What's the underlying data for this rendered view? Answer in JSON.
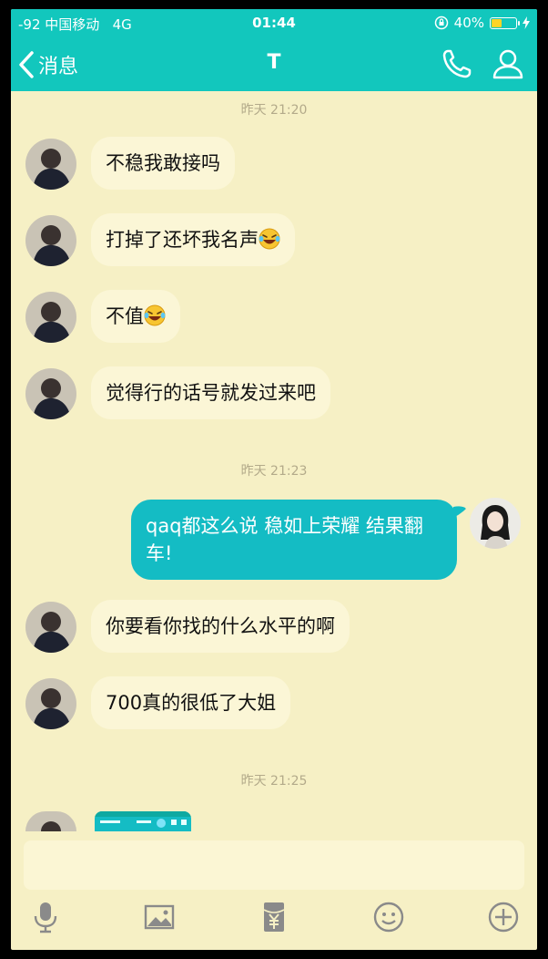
{
  "status_bar": {
    "carrier": "-92 中国移动",
    "network": "4G",
    "time": "01:44",
    "battery": "40%",
    "battery_level": 0.4
  },
  "header": {
    "back_label": "消息",
    "title": "T"
  },
  "messages": {
    "ts1": "昨天 21:20",
    "m1": "不稳我敢接吗",
    "m2": "打掉了还坏我名声",
    "m3": "不值",
    "m4": "觉得行的话号就发过来吧",
    "ts2": "昨天 21:23",
    "m5_line1": "qaq都这么说 稳如上荣耀 结果翻",
    "m5_line2": "车!",
    "m6": "你要看你找的什么水平的啊",
    "m7": "700真的很低了大姐",
    "ts3": "昨天 21:25"
  },
  "colors": {
    "accent": "#12c7bd",
    "bubble_self": "#14bcc4",
    "background": "#f6f0c5",
    "bubble_other": "#fbf6d6"
  },
  "icons": [
    "back-icon",
    "phone-icon",
    "person-icon",
    "microphone-icon",
    "image-icon",
    "red-packet-icon",
    "emoji-icon",
    "plus-icon"
  ]
}
